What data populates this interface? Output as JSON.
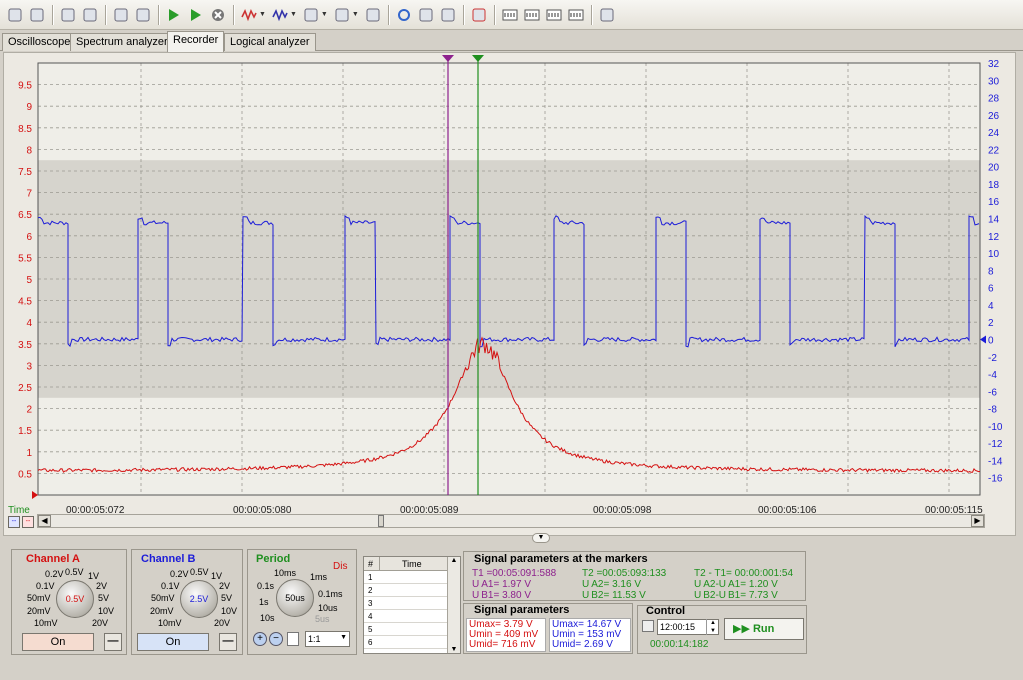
{
  "toolbar": {
    "icons": [
      "open-folder-icon",
      "save-icon",
      "print-preview-icon",
      "print-icon",
      "zoom-icon",
      "export-icon",
      "run-icon",
      "run-continuous-icon",
      "stop-icon",
      "signal-a-icon",
      "signal-b-icon",
      "calculator-icon",
      "math-icon",
      "probe-icon",
      "refresh-icon",
      "delete-icon",
      "view-icon",
      "marker-icon",
      "ch-a-icon",
      "ch-b-icon",
      "ch-ab-icon",
      "ch-ab2-icon",
      "eraser-icon"
    ]
  },
  "tabs": [
    "Oscilloscope",
    "Spectrum analyzer",
    "Recorder",
    "Logical analyzer"
  ],
  "active_tab": "Recorder",
  "colors": {
    "channel_a": "#d41111",
    "channel_b": "#1c1cd8",
    "marker1": "#8d218d",
    "marker2": "#1f8f1f"
  },
  "chart_data": {
    "type": "line",
    "x_axis_label": "Time",
    "x_ticks": [
      "00:00:05:072",
      "00:00:05:080",
      "00:00:05:089",
      "00:00:05:098",
      "00:00:05:106",
      "00:00:05:115"
    ],
    "left_axis": {
      "ticks": [
        "9.5",
        "9",
        "8.5",
        "8",
        "7.5",
        "7",
        "6.5",
        "6",
        "5.5",
        "5",
        "4.5",
        "4",
        "3.5",
        "3",
        "2.5",
        "2",
        "1.5",
        "1",
        "0.5"
      ],
      "range": [
        0,
        10
      ]
    },
    "right_axis": {
      "ticks": [
        "32",
        "30",
        "28",
        "26",
        "24",
        "22",
        "20",
        "18",
        "16",
        "14",
        "12",
        "10",
        "8",
        "6",
        "4",
        "2",
        "0",
        "-2",
        "-4",
        "-6",
        "-8",
        "-10",
        "-12",
        "-14",
        "-16"
      ],
      "range": [
        -18,
        32
      ]
    },
    "series": [
      {
        "name": "Channel A",
        "color": "#d41111",
        "baseline": 0.55,
        "peak": 3.5,
        "peak_time": "00:00:05:092"
      },
      {
        "name": "Channel B",
        "color": "#1c1cd8",
        "low": 0.0,
        "high": 13.5
      }
    ],
    "grid": true,
    "markers": [
      {
        "time": "00:05:091:588"
      },
      {
        "time": "00:05:093:133"
      }
    ]
  },
  "channel_a": {
    "title": "Channel A",
    "value": "0.5V",
    "labels": [
      "0.2V",
      "0.5V",
      "1V",
      "0.1V",
      "2V",
      "50mV",
      "5V",
      "20mV",
      "10V",
      "10mV",
      "20V"
    ],
    "button": "On"
  },
  "channel_b": {
    "title": "Channel B",
    "value": "2.5V",
    "labels": [
      "0.2V",
      "0.5V",
      "1V",
      "0.1V",
      "2V",
      "50mV",
      "5V",
      "20mV",
      "10V",
      "10mV",
      "20V"
    ],
    "button": "On"
  },
  "period": {
    "title": "Period",
    "status": "Dis",
    "value": "50us",
    "labels": [
      "10ms",
      "1ms",
      "0.1s",
      "1s",
      "0.1ms",
      "10s",
      "10us",
      "5us"
    ],
    "ratio": "1:1"
  },
  "marker_table": {
    "col_num": "#",
    "col_time": "Time",
    "rows": [
      "1",
      "2",
      "3",
      "4",
      "5",
      "6"
    ]
  },
  "markers_params": {
    "title": "Signal parameters at the markers",
    "t1": "T1 =00:05:091:588",
    "ua1": "U A1= 1.97 V",
    "ub1": "U B1= 3.80 V",
    "t2": "T2 =00:05:093:133",
    "ua2": "U A2= 3.16 V",
    "ub2": "U B2= 11.53 V",
    "dt": "T2 - T1= 00:00:001:54",
    "dua": "U A2-U A1= 1.20 V",
    "dub": "U B2-U B1= 7.73 V"
  },
  "signal_params": {
    "title": "Signal parameters",
    "a_max": "Umax= 3.79 V",
    "a_min": "Umin = 409 mV",
    "a_mid": "Umid= 716 mV",
    "b_max": "Umax= 14.67 V",
    "b_min": "Umin = 153 mV",
    "b_mid": "Umid=  2.69 V"
  },
  "control": {
    "title": "Control",
    "time_value": "12:00:15",
    "run_label": "Run",
    "elapsed": "00:00:14:182"
  }
}
